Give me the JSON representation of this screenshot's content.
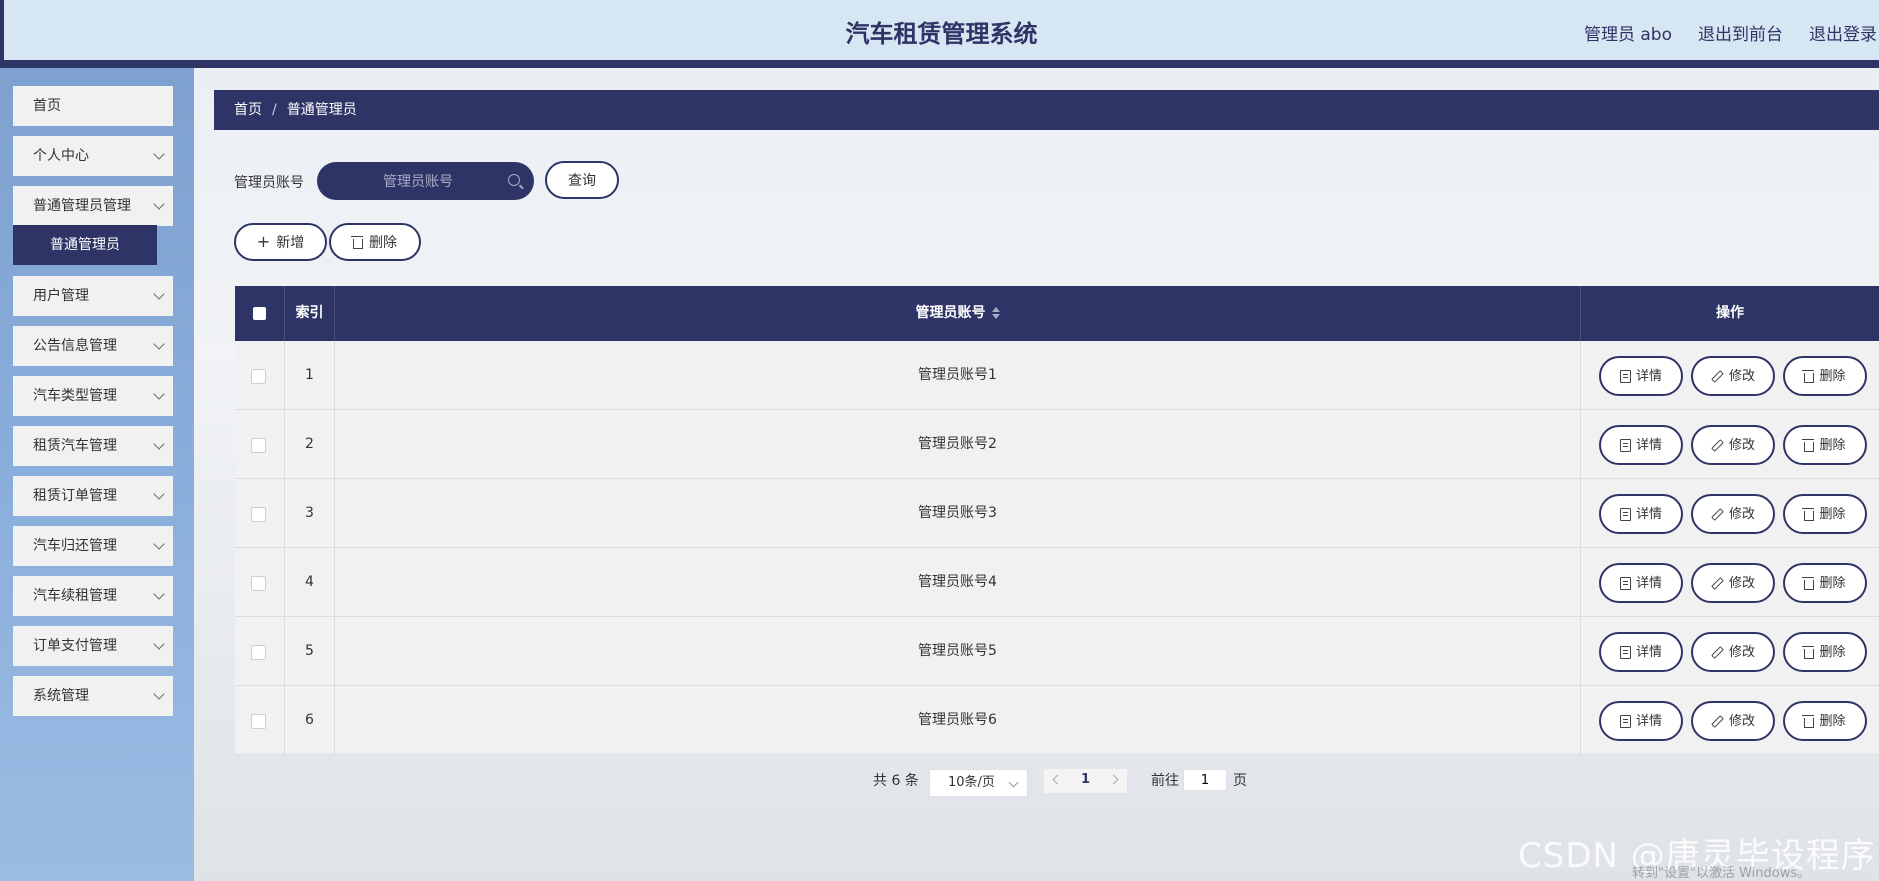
{
  "header": {
    "title": "汽车租赁管理系统",
    "user": "管理员 abo",
    "front_link": "退出到前台",
    "logout": "退出登录"
  },
  "sidebar": {
    "items": [
      {
        "label": "首页"
      },
      {
        "label": "个人中心"
      },
      {
        "label": "普通管理员管理"
      },
      {
        "label": "用户管理"
      },
      {
        "label": "公告信息管理"
      },
      {
        "label": "汽车类型管理"
      },
      {
        "label": "租赁汽车管理"
      },
      {
        "label": "租赁订单管理"
      },
      {
        "label": "汽车归还管理"
      },
      {
        "label": "汽车续租管理"
      },
      {
        "label": "订单支付管理"
      },
      {
        "label": "系统管理"
      }
    ],
    "active_sub": "普通管理员"
  },
  "breadcrumb": {
    "home": "首页",
    "sep": "/",
    "current": "普通管理员"
  },
  "search": {
    "label": "管理员账号",
    "placeholder": "管理员账号",
    "button": "查询"
  },
  "toolbar": {
    "add": "新增",
    "delete": "删除"
  },
  "table": {
    "columns": {
      "index": "索引",
      "account": "管理员账号",
      "actions": "操作"
    },
    "rows": [
      {
        "index": "1",
        "account": "管理员账号1"
      },
      {
        "index": "2",
        "account": "管理员账号2"
      },
      {
        "index": "3",
        "account": "管理员账号3"
      },
      {
        "index": "4",
        "account": "管理员账号4"
      },
      {
        "index": "5",
        "account": "管理员账号5"
      },
      {
        "index": "6",
        "account": "管理员账号6"
      }
    ],
    "actions": {
      "detail": "详情",
      "edit": "修改",
      "delete": "删除"
    }
  },
  "pagination": {
    "total": "共 6 条",
    "page_size": "10条/页",
    "current": "1",
    "goto_label": "前往",
    "goto_value": "1",
    "page_unit": "页"
  },
  "overlay": {
    "watermark": "CSDN @唐灵毕设程序",
    "activation": "转到\"设置\"以激活 Windows。"
  },
  "colors": {
    "primary": "#2f3466",
    "header_bg": "#d6e6f2",
    "sidebar_bg": "#8aaedb",
    "row_bg": "#f1f1f1"
  }
}
